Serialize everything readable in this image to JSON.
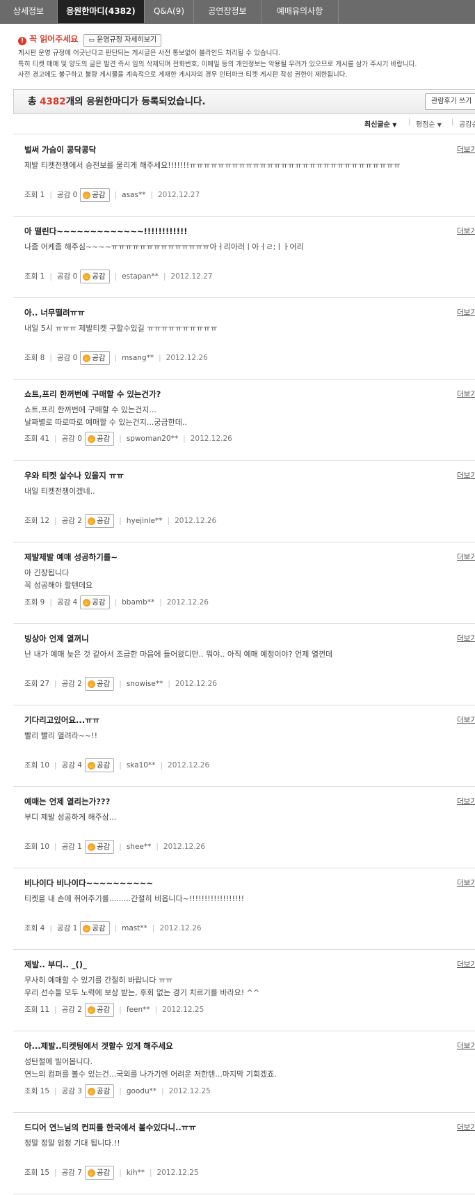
{
  "tabs": [
    {
      "label": "상세정보"
    },
    {
      "label": "응원한마디(4382)"
    },
    {
      "label": "Q&A(9)"
    },
    {
      "label": "공연장정보"
    },
    {
      "label": "예매유의사항"
    }
  ],
  "notice": {
    "title": "꼭 읽어주세요",
    "rule_button": "운영규정 자세히보기",
    "lines": [
      "게시판 운영 규정에 어긋난다고 판단되는 게시글은 사전 통보없이 블라인드 처리될 수 있습니다.",
      "특히 티켓 매매 및 양도의 글은 발견 즉시 임의 삭제되며 전화번호, 이메일 등의 개인정보는 악용될 우려가 있으므로 게시를 삼가 주시기 바랍니다.",
      "사전 경고에도 불구하고 불량 게시물을 계속적으로 게재한 게시자의 경우 인터파크 티켓 게시판 작성 권한이 제한됩니다."
    ]
  },
  "count_bar": {
    "prefix": "총 ",
    "count": "4382",
    "suffix": "개의 응원한마디가 등록되었습니다.",
    "write_button": "관람후기 쓰기"
  },
  "sort": {
    "latest": "최신글순",
    "rating": "평점순",
    "empathy": "공감순"
  },
  "meta_labels": {
    "views": "조회",
    "empathy": "공감",
    "like_button": "공감",
    "more": "더보기"
  },
  "posts": [
    {
      "title": "벌써 가슴이 콩닥콩닥",
      "body": [
        "제발 티켓전쟁에서 승전보를 울리게 해주세요!!!!!!!ㅠㅠㅠㅠㅠㅠㅠㅠㅠㅠㅠㅠㅠㅠㅠㅠㅠㅠㅠㅠㅠㅠㅠㅠㅠㅠㅠㅠㅠㅠ",
        ""
      ],
      "views": "1",
      "likes": "0",
      "author": "asas**",
      "date": "2012.12.27"
    },
    {
      "title": "아 떨린다~~~~~~~~~~~~~!!!!!!!!!!!!",
      "body": [
        "나좀 어케좀 해주심~~~~ㅠㅠㅠㅠㅠㅠㅠㅠㅠㅠㅠㅠㅠㅠ아ㅓ리아러ㅣ아ㅓㄹ;ㅣㅏ어리",
        ""
      ],
      "views": "1",
      "likes": "0",
      "author": "estapan**",
      "date": "2012.12.27"
    },
    {
      "title": "아.. 너무떨려ㅠㅠ",
      "body": [
        "내일 5시 ㅠㅠㅠ 제발티켓 구할수있길 ㅠㅠㅠㅠㅠㅠㅠㅠㅠㅠ",
        ""
      ],
      "views": "8",
      "likes": "0",
      "author": "msang**",
      "date": "2012.12.26"
    },
    {
      "title": "쇼트,프리 한꺼번에 구매할 수 있는건가?",
      "body": [
        "쇼트,프리 한꺼번에 구매할 수 있는건지...",
        "날짜별로 따로따로 예매할 수 있는건지...궁금한데.."
      ],
      "views": "41",
      "likes": "0",
      "author": "spwoman20**",
      "date": "2012.12.26"
    },
    {
      "title": "우와 티켓 살수나 있을지 ㅠㅠ",
      "body": [
        "내일 티켓전쟁이겠네..",
        ""
      ],
      "views": "12",
      "likes": "2",
      "author": "hyejinle**",
      "date": "2012.12.26"
    },
    {
      "title": "제발제발 예매 성공하기를~",
      "body": [
        "아 긴장됩니다",
        "꼭 성공해야 할텐데요"
      ],
      "views": "9",
      "likes": "4",
      "author": "bbamb**",
      "date": "2012.12.26"
    },
    {
      "title": "빙상아 언제 열꺼니",
      "body": [
        "난 내가 예매 늦은 것 같아서 조급한 마음에 들어왔디만.. 뭐야.. 아직 예매 예정이야? 언제 열껀데",
        ""
      ],
      "views": "27",
      "likes": "2",
      "author": "snowise**",
      "date": "2012.12.26"
    },
    {
      "title": "기다리고있어요...ㅠㅠ",
      "body": [
        "빨리 빨리 열려라~~!!",
        ""
      ],
      "views": "10",
      "likes": "4",
      "author": "ska10**",
      "date": "2012.12.26"
    },
    {
      "title": "예매는 언제 열리는가???",
      "body": [
        "",
        "부디 제발 성공하게 해주삼..."
      ],
      "views": "10",
      "likes": "1",
      "author": "shee**",
      "date": "2012.12.26"
    },
    {
      "title": "비나이다 비나이다~~~~~~~~~~",
      "body": [
        "",
        "티켓을 내 손에 쥐어주기를.........간절히 비옵니다~!!!!!!!!!!!!!!!!!!"
      ],
      "views": "4",
      "likes": "1",
      "author": "mast**",
      "date": "2012.12.26"
    },
    {
      "title": "제발.. 부디.. _()_",
      "body": [
        "무사히 예매할 수 있기를 간절히 바랍니다 ㅠㅠ",
        "우리 선수들 모두 노력에 보상 받는, 후회 없는 경기 치르기를 바라요! ^^"
      ],
      "views": "11",
      "likes": "2",
      "author": "feen**",
      "date": "2012.12.25"
    },
    {
      "title": "아...제발..티켓팅에서 겟할수 있게 해주세요",
      "body": [
        "성탄절에 빌어봅니다.",
        "연느의 컴퍼를 볼수 있는건...국외를 나가기엔 어려운 저한텐...마지막 기회겠죠."
      ],
      "views": "15",
      "likes": "3",
      "author": "goodu**",
      "date": "2012.12.25"
    },
    {
      "title": "드디어 연느님의 컨피를 한국에서 볼수있다니..ㅠㅠ",
      "body": [
        "정말 정말 엄청 기대 됩니다.!!",
        ""
      ],
      "views": "15",
      "likes": "7",
      "author": "kih**",
      "date": "2012.12.25"
    }
  ]
}
